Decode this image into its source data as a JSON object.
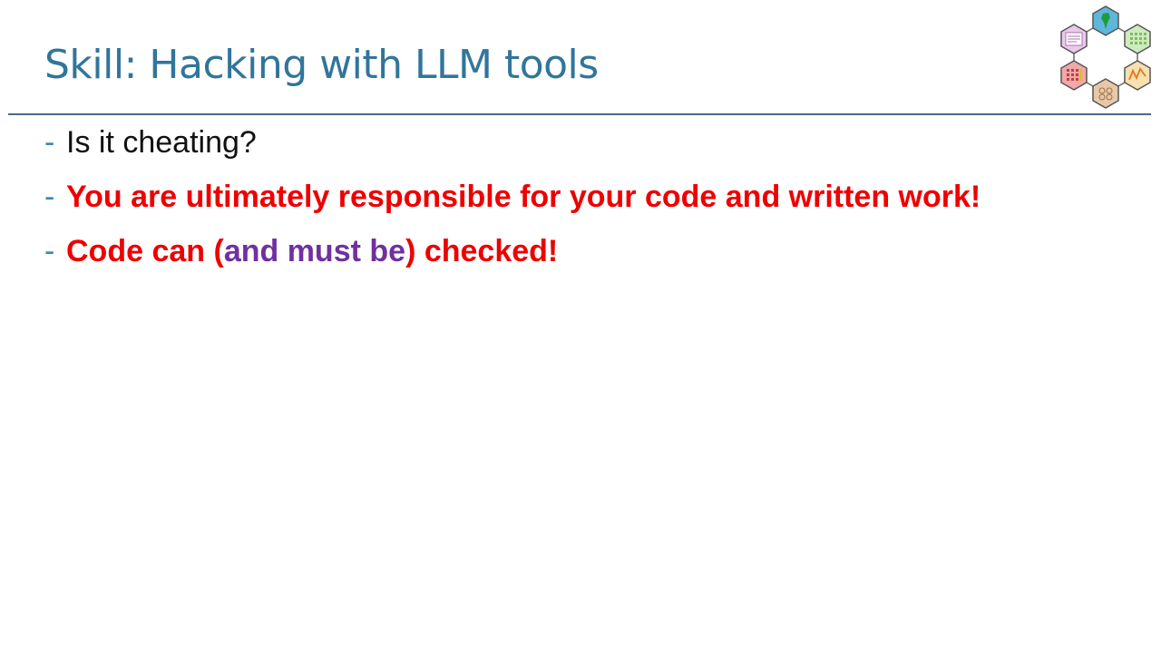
{
  "slide": {
    "title": "Skill: Hacking with LLM tools",
    "bullet_marker": "-",
    "bullets": [
      {
        "text": "Is it cheating?"
      },
      {
        "text": "You are ultimately responsible for your code and written work!"
      },
      {
        "part1": "Code can (",
        "part2": "and must be",
        "part3": ") checked!"
      }
    ]
  },
  "colors": {
    "title": "#31759b",
    "marker": "#3a87b8",
    "emphasis_red": "#ee0000",
    "emphasis_purple": "#7030a0",
    "divider": "#4a6a8a"
  },
  "logo": {
    "icon": "hexagon-cluster-logo-icon"
  }
}
